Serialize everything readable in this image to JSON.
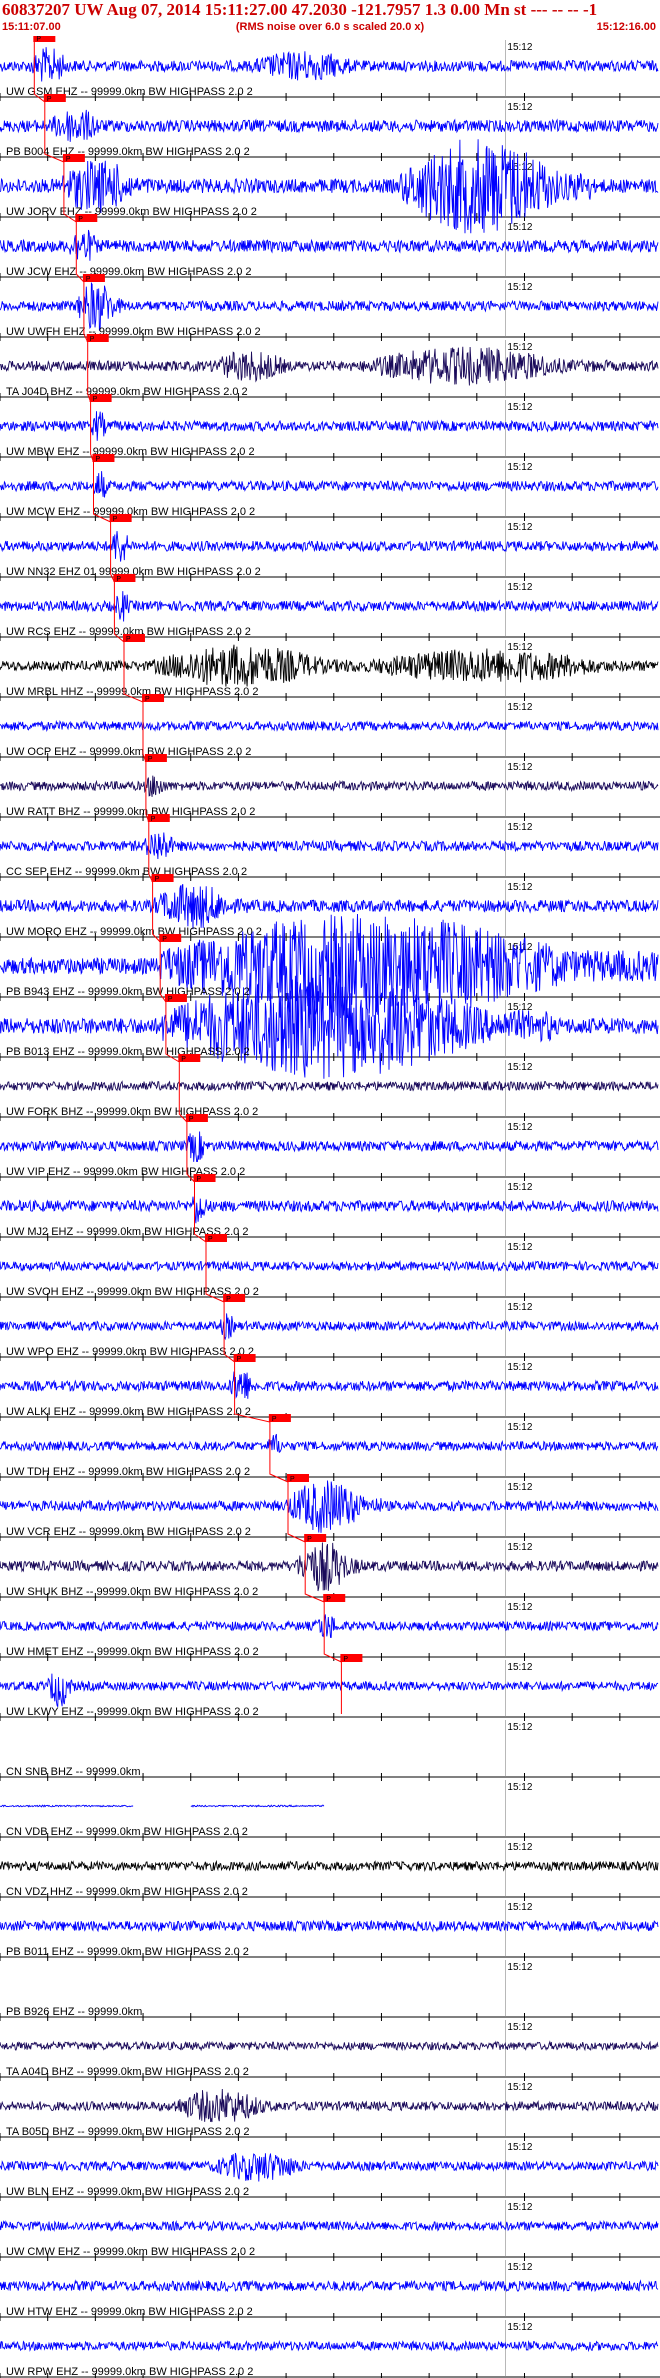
{
  "header": {
    "title": "60837207 UW Aug 07, 2014 15:11:27.00   47.2030 -121.7957  1.3 0.00 Mn st --- -- --  -1",
    "start_time": "15:11:07.00",
    "end_time": "15:12:16.00",
    "rms_note": "(RMS noise over 6.0 s scaled 20.0 x)"
  },
  "colors": {
    "title": "#cc0000",
    "trace_blue": "#0000ff",
    "trace_dark": "#1a0a5a",
    "pick_line": "#ff0000",
    "pick_box": "#ff0000",
    "grid": "#000000"
  },
  "chart_data": {
    "type": "seismogram",
    "x_range_seconds": [
      0,
      69
    ],
    "x_start_label": "15:11:07.00",
    "x_end_label": "15:12:16.00",
    "minute_marker_label": "15:12",
    "minute_marker_second": 53,
    "tick_interval_seconds": 5,
    "pick_label": "P",
    "traces": [
      {
        "label": "UW GSM EHZ -- 99999.0km BW  HIGHPASS  2.0  2",
        "color": "#0000ff",
        "amp": 0.55,
        "pick": 3.6,
        "bursts": [
          [
            3,
            8,
            1.6
          ],
          [
            26,
            40,
            1.3
          ]
        ]
      },
      {
        "label": "PB B004 EHZ -- 99999.0km BW  HIGHPASS  2.0  2",
        "color": "#0000ff",
        "amp": 0.6,
        "pick": 4.7,
        "bursts": [
          [
            5,
            12,
            1.4
          ]
        ]
      },
      {
        "label": "UW JORV EHZ -- 99999.0km BW  HIGHPASS  2.0  2",
        "color": "#0000ff",
        "amp": 0.7,
        "pick": 6.7,
        "bursts": [
          [
            6,
            16,
            1.8
          ],
          [
            42,
            62,
            3.2
          ]
        ]
      },
      {
        "label": "UW JCW EHZ -- 99999.0km BW  HIGHPASS  2.0  2",
        "color": "#0000ff",
        "amp": 0.6,
        "pick": 8.0,
        "bursts": [
          [
            7,
            11,
            1.4
          ]
        ]
      },
      {
        "label": "UW UWFH EHZ -- 99999.0km BW  HIGHPASS  2.0  2",
        "color": "#0000ff",
        "amp": 0.5,
        "pick": 8.8,
        "bursts": [
          [
            8,
            13,
            2.4
          ]
        ]
      },
      {
        "label": "TA J04D BHZ -- 99999.0km BW  HIGHPASS  2.0  2",
        "color": "#1a0a5a",
        "amp": 0.5,
        "pick": 9.2,
        "bursts": [
          [
            22,
            32,
            1.5
          ],
          [
            38,
            64,
            1.8
          ]
        ]
      },
      {
        "label": "UW MBW EHZ -- 99999.0km BW  HIGHPASS  2.0  2",
        "color": "#0000ff",
        "amp": 0.5,
        "pick": 9.5,
        "bursts": [
          [
            9.5,
            11.5,
            1.5
          ]
        ]
      },
      {
        "label": "UW MCW EHZ -- 99999.0km BW  HIGHPASS  2.0  2",
        "color": "#0000ff",
        "amp": 0.5,
        "pick": 9.8,
        "bursts": [
          [
            9.8,
            11.5,
            1.6
          ]
        ]
      },
      {
        "label": "UW NN32 EHZ 01 99999.0km BW  HIGHPASS  2.0  2",
        "color": "#0000ff",
        "amp": 0.5,
        "pick": 11.6,
        "bursts": [
          [
            11.5,
            14,
            1.8
          ]
        ]
      },
      {
        "label": "UW RCS EHZ -- 99999.0km BW  HIGHPASS  2.0  2",
        "color": "#0000ff",
        "amp": 0.5,
        "pick": 12.0,
        "bursts": [
          [
            12,
            14,
            1.5
          ]
        ]
      },
      {
        "label": "UW MRBL HHZ -- 99999.0km BW  HIGHPASS  2.0  2",
        "color": "#000000",
        "amp": 0.5,
        "pick": 13.0,
        "bursts": [
          [
            16,
            38,
            2.0
          ],
          [
            38,
            69,
            1.6
          ]
        ]
      },
      {
        "label": "UW OCP EHZ -- 99999.0km BW  HIGHPASS  2.0  2",
        "color": "#0000ff",
        "amp": 0.45,
        "pick": 15.0,
        "bursts": []
      },
      {
        "label": "UW RATT BHZ -- 99999.0km BW  HIGHPASS  2.0  2",
        "color": "#1a0a5a",
        "amp": 0.45,
        "pick": 15.3,
        "bursts": [
          [
            15,
            18,
            1.3
          ]
        ]
      },
      {
        "label": "CC SEP EHZ -- 99999.0km BW  HIGHPASS  2.0  2",
        "color": "#0000ff",
        "amp": 0.5,
        "pick": 15.6,
        "bursts": [
          [
            15,
            19,
            1.6
          ]
        ]
      },
      {
        "label": "UW MORQ EHZ -- 99999.0km BW  HIGHPASS  2.0  2",
        "color": "#0000ff",
        "amp": 0.6,
        "pick": 16.0,
        "bursts": [
          [
            16,
            26,
            1.8
          ]
        ]
      },
      {
        "label": "PB B943 EHZ -- 99999.0km BW  HIGHPASS  2.0  2",
        "color": "#0000ff",
        "amp": 0.8,
        "pick": 16.8,
        "bursts": [
          [
            16.5,
            69,
            3.0
          ]
        ]
      },
      {
        "label": "PB B013 EHZ -- 99999.0km BW  HIGHPASS  2.0  2",
        "color": "#0000ff",
        "amp": 0.8,
        "pick": 17.4,
        "bursts": [
          [
            17,
            58,
            3.0
          ]
        ]
      },
      {
        "label": "UW FORK BHZ -- 99999.0km BW  HIGHPASS  2.0  2",
        "color": "#1a0a5a",
        "amp": 0.45,
        "pick": 18.8,
        "bursts": []
      },
      {
        "label": "UW VIP EHZ -- 99999.0km BW  HIGHPASS  2.0  2",
        "color": "#0000ff",
        "amp": 0.5,
        "pick": 19.6,
        "bursts": [
          [
            19.5,
            22,
            1.6
          ]
        ]
      },
      {
        "label": "UW MJ2 EHZ -- 99999.0km BW  HIGHPASS  2.0  2",
        "color": "#0000ff",
        "amp": 0.55,
        "pick": 20.4,
        "bursts": [
          [
            20,
            22,
            1.7
          ]
        ]
      },
      {
        "label": "UW SVOH EHZ -- 99999.0km BW  HIGHPASS  2.0  2",
        "color": "#0000ff",
        "amp": 0.45,
        "pick": 21.6,
        "bursts": []
      },
      {
        "label": "UW WPO EHZ -- 99999.0km BW  HIGHPASS  2.0  2",
        "color": "#0000ff",
        "amp": 0.45,
        "pick": 23.5,
        "bursts": [
          [
            23,
            25,
            1.4
          ]
        ]
      },
      {
        "label": "UW ALKI EHZ -- 99999.0km BW  HIGHPASS  2.0  2",
        "color": "#0000ff",
        "amp": 0.5,
        "pick": 24.6,
        "bursts": [
          [
            24,
            27,
            1.8
          ]
        ]
      },
      {
        "label": "UW TDH EHZ -- 99999.0km BW  HIGHPASS  2.0  2",
        "color": "#0000ff",
        "amp": 0.45,
        "pick": 28.3,
        "bursts": [
          [
            28,
            30,
            1.3
          ]
        ]
      },
      {
        "label": "UW VCR EHZ -- 99999.0km BW  HIGHPASS  2.0  2",
        "color": "#0000ff",
        "amp": 0.5,
        "pick": 30.2,
        "bursts": [
          [
            30,
            40,
            2.5
          ]
        ]
      },
      {
        "label": "UW SHUK BHZ -- 99999.0km BW  HIGHPASS  2.0  2",
        "color": "#1a0a5a",
        "amp": 0.5,
        "pick": 32.0,
        "bursts": [
          [
            31,
            38,
            2.4
          ]
        ]
      },
      {
        "label": "UW HMET EHZ -- 99999.0km BW  HIGHPASS  2.0  2",
        "color": "#0000ff",
        "amp": 0.45,
        "pick": 34.0,
        "bursts": [
          [
            33,
            36,
            1.5
          ]
        ]
      },
      {
        "label": "UW LKWY EHZ -- 99999.0km BW  HIGHPASS  2.0  2",
        "color": "#0000ff",
        "amp": 0.45,
        "pick": 35.8,
        "bursts": [
          [
            5,
            8,
            2.2
          ]
        ]
      },
      {
        "label": "CN SNB BHZ -- 99999.0km",
        "color": "#0000ff",
        "amp": 0.0,
        "bursts": []
      },
      {
        "label": "CN VDB EHZ -- 99999.0km BW  HIGHPASS  2.0  2",
        "color": "#0000ff",
        "amp": 0.08,
        "gaps": [
          [
            14,
            20
          ],
          [
            34,
            69
          ]
        ],
        "bursts": []
      },
      {
        "label": "CN VDZ HHZ -- 99999.0km BW  HIGHPASS  2.0  2",
        "color": "#000000",
        "amp": 0.45,
        "bursts": []
      },
      {
        "label": "PB B011 EHZ -- 99999.0km BW  HIGHPASS  2.0  2",
        "color": "#0000ff",
        "amp": 0.5,
        "bursts": []
      },
      {
        "label": "PB B926 EHZ -- 99999.0km",
        "color": "#0000ff",
        "amp": 0.0,
        "bursts": []
      },
      {
        "label": "TA A04D BHZ -- 99999.0km BW  HIGHPASS  2.0  2",
        "color": "#1a0a5a",
        "amp": 0.4,
        "bursts": []
      },
      {
        "label": "TA B05D BHZ -- 99999.0km BW  HIGHPASS  2.0  2",
        "color": "#1a0a5a",
        "amp": 0.45,
        "bursts": [
          [
            18,
            30,
            1.8
          ]
        ]
      },
      {
        "label": "UW BLN EHZ -- 99999.0km BW  HIGHPASS  2.0  2",
        "color": "#0000ff",
        "amp": 0.45,
        "bursts": [
          [
            22,
            34,
            1.6
          ]
        ]
      },
      {
        "label": "UW CMW EHZ -- 99999.0km BW  HIGHPASS  2.0  2",
        "color": "#0000ff",
        "amp": 0.45,
        "bursts": []
      },
      {
        "label": "UW HTW EHZ -- 99999.0km BW  HIGHPASS  2.0  2",
        "color": "#0000ff",
        "amp": 0.5,
        "bursts": []
      },
      {
        "label": "UW RPW EHZ -- 99999.0km BW  HIGHPASS  2.0  2",
        "color": "#0000ff",
        "amp": 0.45,
        "bursts": []
      }
    ]
  }
}
